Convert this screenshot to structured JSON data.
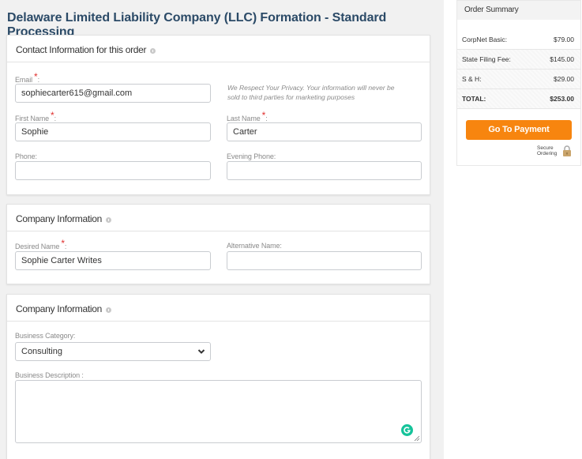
{
  "page": {
    "title": "Delaware Limited Liability Company (LLC) Formation - Standard Processing"
  },
  "contact_section": {
    "header": "Contact Information for this order",
    "email_label": "Email",
    "email_value": "sophiecarter615@gmail.com",
    "privacy_note_line1": "We Respect Your Privacy. Your information will never be",
    "privacy_note_line2": "sold to third parties for marketing purposes",
    "first_name_label": "First Name",
    "first_name_value": "Sophie",
    "last_name_label": "Last Name",
    "last_name_value": "Carter",
    "phone_label": "Phone:",
    "phone_value": "",
    "evening_phone_label": "Evening Phone:",
    "evening_phone_value": "",
    "required_mark": "*",
    "colon": ":"
  },
  "company_section": {
    "header": "Company Information",
    "desired_name_label": "Desired Name",
    "desired_name_value": "Sophie Carter Writes",
    "alternative_name_label": "Alternative Name:",
    "alternative_name_value": ""
  },
  "business_section": {
    "header": "Company Information",
    "category_label": "Business Category:",
    "category_value": "Consulting",
    "description_label": "Business Description :",
    "description_value": ""
  },
  "order_summary": {
    "title": "Order Summary",
    "rows": [
      {
        "label": "CorpNet Basic:",
        "value": "$79.00"
      },
      {
        "label": "State Filing Fee:",
        "value": "$145.00"
      },
      {
        "label": "S & H:",
        "value": "$29.00"
      }
    ],
    "total_label": "TOTAL:",
    "total_value": "$253.00",
    "payment_button": "Go To Payment",
    "secure_line1": "Secure",
    "secure_line2": "Ordering"
  },
  "colors": {
    "accent": "#f7850f",
    "title": "#2b4a67",
    "required": "#e0312f",
    "grammarly": "#15c39a"
  }
}
